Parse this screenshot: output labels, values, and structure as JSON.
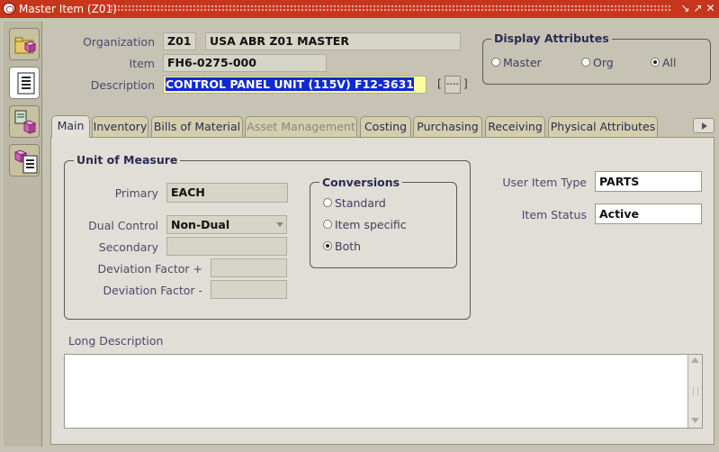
{
  "window": {
    "title": "Master Item (Z01)"
  },
  "header": {
    "organization_label": "Organization",
    "organization_code": "Z01",
    "organization_name": "USA ABR Z01 MASTER",
    "item_label": "Item",
    "item_value": "FH6-0275-000",
    "description_label": "Description",
    "description_value": "CONTROL PANEL UNIT (115V) F12-3631",
    "lov_button": "----"
  },
  "display_attributes": {
    "title": "Display Attributes",
    "options": [
      "Master",
      "Org",
      "All"
    ],
    "selected": "All"
  },
  "tabs": [
    {
      "label": "Main",
      "active": true
    },
    {
      "label": "Inventory"
    },
    {
      "label": "Bills of Material"
    },
    {
      "label": "Asset Management",
      "disabled": true
    },
    {
      "label": "Costing"
    },
    {
      "label": "Purchasing"
    },
    {
      "label": "Receiving"
    },
    {
      "label": "Physical Attributes"
    }
  ],
  "unit_of_measure": {
    "title": "Unit of Measure",
    "primary_label": "Primary",
    "primary_value": "EACH",
    "dual_control_label": "Dual Control",
    "dual_control_value": "Non-Dual",
    "secondary_label": "Secondary",
    "secondary_value": "",
    "deviation_plus_label": "Deviation Factor +",
    "deviation_plus_value": "",
    "deviation_minus_label": "Deviation Factor -",
    "deviation_minus_value": ""
  },
  "conversions": {
    "title": "Conversions",
    "options": [
      "Standard",
      "Item specific",
      "Both"
    ],
    "selected": "Both"
  },
  "item_info": {
    "user_item_type_label": "User Item Type",
    "user_item_type_value": "PARTS",
    "item_status_label": "Item Status",
    "item_status_value": "Active"
  },
  "long_description": {
    "label": "Long Description",
    "value": ""
  },
  "colors": {
    "title_bar": "#c7351c",
    "selection": "#0e2bd0",
    "highlight_field": "#fffa9e"
  }
}
